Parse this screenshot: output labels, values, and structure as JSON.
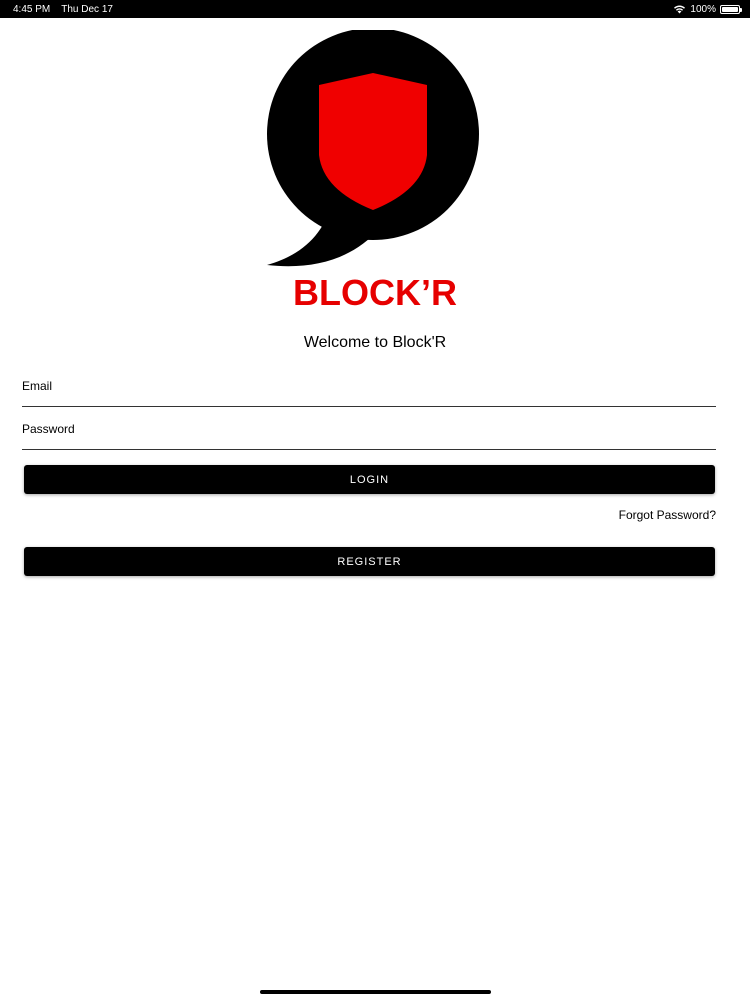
{
  "status_bar": {
    "time": "4:45 PM",
    "date": "Thu Dec 17",
    "battery_percent": "100%",
    "battery_level": 1.0,
    "icons": [
      "wifi-icon",
      "battery-icon"
    ]
  },
  "brand": {
    "wordmark": "BLOCK’R",
    "logo_icon": "speech-bubble-shield-icon",
    "colors": {
      "red": "#e60000",
      "black": "#000000"
    }
  },
  "login": {
    "welcome": "Welcome to Block'R",
    "email_placeholder": "Email",
    "password_placeholder": "Password",
    "login_label": "LOGIN",
    "forgot_password": "Forgot Password?",
    "register_label": "REGISTER"
  }
}
